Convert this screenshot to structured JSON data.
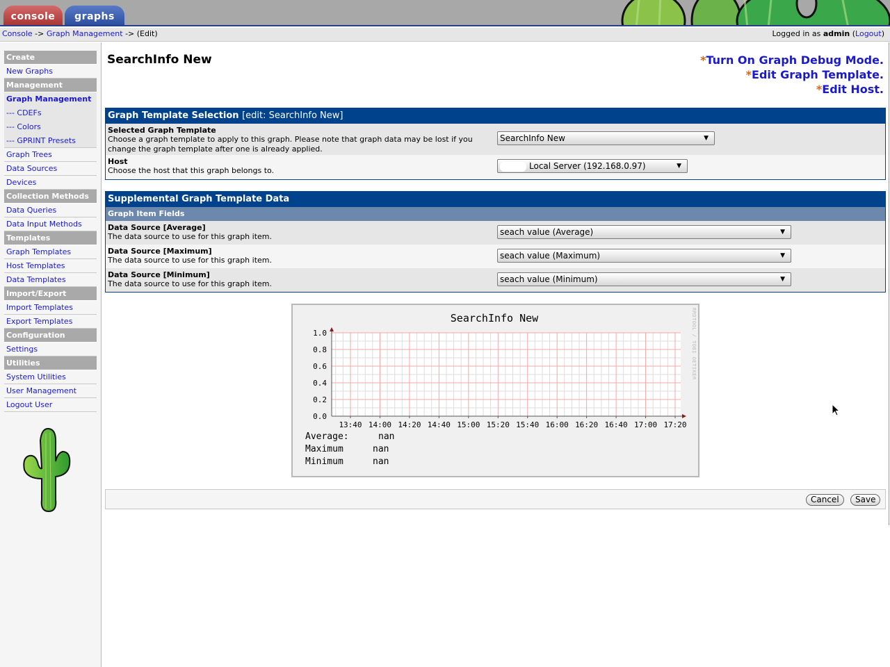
{
  "tabs": [
    {
      "label": "console",
      "active": false
    },
    {
      "label": "graphs",
      "active": true
    }
  ],
  "breadcrumb": {
    "items": [
      "Console",
      "Graph Management"
    ],
    "separator": "->",
    "current": "(Edit)"
  },
  "login": {
    "prefix": "Logged in as",
    "user": "admin",
    "logout_label": "Logout"
  },
  "sidebar": {
    "sections": [
      {
        "header": "Create",
        "items": [
          "New Graphs"
        ]
      },
      {
        "header": "Management",
        "items": [
          "Graph Management",
          "--- CDEFs",
          "--- Colors",
          "--- GPRINT Presets",
          "Graph Trees",
          "Data Sources",
          "Devices"
        ]
      },
      {
        "header": "Collection Methods",
        "items": [
          "Data Queries",
          "Data Input Methods"
        ]
      },
      {
        "header": "Templates",
        "items": [
          "Graph Templates",
          "Host Templates",
          "Data Templates"
        ]
      },
      {
        "header": "Import/Export",
        "items": [
          "Import Templates",
          "Export Templates"
        ]
      },
      {
        "header": "Configuration",
        "items": [
          "Settings"
        ]
      },
      {
        "header": "Utilities",
        "items": [
          "System Utilities",
          "User Management",
          "Logout User"
        ]
      }
    ],
    "active_item": "Graph Management"
  },
  "page": {
    "title": "SearchInfo New",
    "actions": [
      {
        "star": "*",
        "label": "Turn On Graph Debug Mode."
      },
      {
        "star": "*",
        "label": "Edit Graph Template."
      },
      {
        "star": "*",
        "label": "Edit Host."
      }
    ]
  },
  "template_panel": {
    "title": "Graph Template Selection",
    "subtitle": "[edit: SearchInfo New]",
    "rows": [
      {
        "label": "Selected Graph Template",
        "description": "Choose a graph template to apply to this graph. Please note that graph data may be lost if you change the graph template after one is already applied.",
        "value": "SearchInfo New"
      },
      {
        "label": "Host",
        "description": "Choose the host that this graph belongs to.",
        "value": "Local Server (192.168.0.97)"
      }
    ]
  },
  "supplemental_panel": {
    "title": "Supplemental Graph Template Data",
    "subheader": "Graph Item Fields",
    "rows": [
      {
        "label": "Data Source [Average]",
        "description": "The data source to use for this graph item.",
        "value": "seach value (Average)"
      },
      {
        "label": "Data Source [Maximum]",
        "description": "The data source to use for this graph item.",
        "value": "seach value (Maximum)"
      },
      {
        "label": "Data Source [Minimum]",
        "description": "The data source to use for this graph item.",
        "value": "seach value (Minimum)"
      }
    ]
  },
  "graph": {
    "title": "SearchInfo New",
    "watermark": "RRDTOOL / TOBI OETIKER",
    "y_ticks": [
      "0.0",
      "0.2",
      "0.4",
      "0.6",
      "0.8",
      "1.0"
    ],
    "x_ticks": [
      "13:40",
      "14:00",
      "14:20",
      "14:40",
      "15:00",
      "15:20",
      "15:40",
      "16:00",
      "16:20",
      "16:40",
      "17:00",
      "17:20"
    ],
    "legend": [
      {
        "label": "Average:",
        "value": "nan"
      },
      {
        "label": "Maximum",
        "value": "nan"
      },
      {
        "label": "Minimum",
        "value": "nan"
      }
    ]
  },
  "buttons": {
    "cancel": "Cancel",
    "save": "Save"
  },
  "chart_data": {
    "type": "line",
    "title": "SearchInfo New",
    "xlabel": "",
    "ylabel": "",
    "x": [
      "13:40",
      "14:00",
      "14:20",
      "14:40",
      "15:00",
      "15:20",
      "15:40",
      "16:00",
      "16:20",
      "16:40",
      "17:00",
      "17:20"
    ],
    "ylim": [
      0.0,
      1.0
    ],
    "yticks": [
      0.0,
      0.2,
      0.4,
      0.6,
      0.8,
      1.0
    ],
    "grid": true,
    "series": [
      {
        "name": "Average",
        "values": [],
        "summary": "nan"
      },
      {
        "name": "Maximum",
        "values": [],
        "summary": "nan"
      },
      {
        "name": "Minimum",
        "values": [],
        "summary": "nan"
      }
    ],
    "legend_position": "bottom-left"
  }
}
